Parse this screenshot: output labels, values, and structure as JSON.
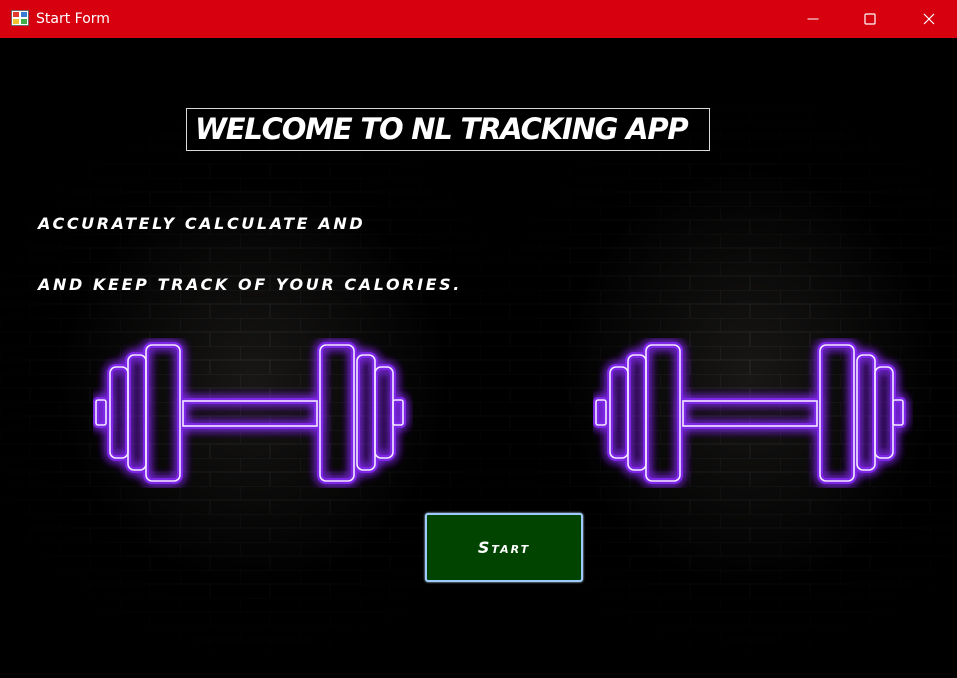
{
  "window": {
    "title": "Start Form",
    "titlebar_color": "#d6000f",
    "controls": [
      "minimize-icon",
      "maximize-icon",
      "close-icon"
    ]
  },
  "main": {
    "welcome_title": "WELCOME TO NL TRACKING APP",
    "tagline_line1": "ACCURATELY CALCULATE AND",
    "tagline_line2": "AND KEEP TRACK OF YOUR CALORIES.",
    "decorations": [
      "dumbbell-icon",
      "dumbbell-icon"
    ],
    "neon_color": "#8a2bff",
    "start_button": {
      "label": "Start",
      "background": "#004400",
      "border": "#9ecbff"
    }
  }
}
